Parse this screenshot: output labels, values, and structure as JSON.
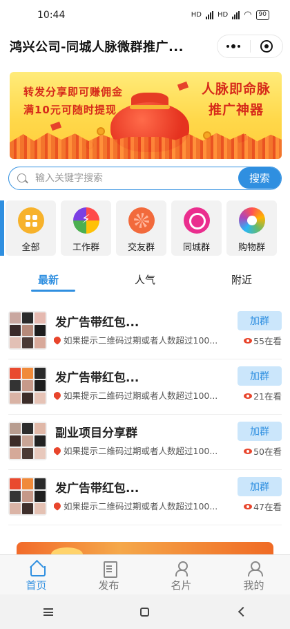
{
  "status": {
    "time": "10:44",
    "net1": "HD",
    "net2": "HD",
    "battery": "90"
  },
  "titlebar": {
    "title": "鸿兴公司-同城人脉微群推广..."
  },
  "banner": {
    "line1": "转发分享即可赚佣金",
    "line2": "满10元可随时提现",
    "right1": "人脉即命脉",
    "right2": "推广神器"
  },
  "search": {
    "placeholder": "输入关键字搜索",
    "button": "搜索"
  },
  "categories": [
    {
      "label": "全部",
      "icon": "grid-icon"
    },
    {
      "label": "工作群",
      "icon": "work-icon"
    },
    {
      "label": "交友群",
      "icon": "friend-icon"
    },
    {
      "label": "同城群",
      "icon": "city-icon"
    },
    {
      "label": "购物群",
      "icon": "shop-icon"
    }
  ],
  "tabs": [
    "最新",
    "人气",
    "附近"
  ],
  "groups": [
    {
      "name": "发广告带红包...",
      "desc": "如果提示二维码过期或者人数超过100...",
      "join": "加群",
      "online": "55在看"
    },
    {
      "name": "发广告带红包...",
      "desc": "如果提示二维码过期或者人数超过100...",
      "join": "加群",
      "online": "21在看"
    },
    {
      "name": "副业项目分享群",
      "desc": "如果提示二维码过期或者人数超过100...",
      "join": "加群",
      "online": "50在看"
    },
    {
      "name": "发广告带红包...",
      "desc": "如果提示二维码过期或者人数超过100...",
      "join": "加群",
      "online": "47在看"
    }
  ],
  "tabbar": [
    {
      "label": "首页",
      "icon": "home-icon"
    },
    {
      "label": "发布",
      "icon": "publish-icon"
    },
    {
      "label": "名片",
      "icon": "card-icon"
    },
    {
      "label": "我的",
      "icon": "profile-icon"
    }
  ],
  "colors": {
    "accent": "#2f8fe0",
    "banner_text": "#d62a1a",
    "join_bg": "#cbe6fb"
  }
}
